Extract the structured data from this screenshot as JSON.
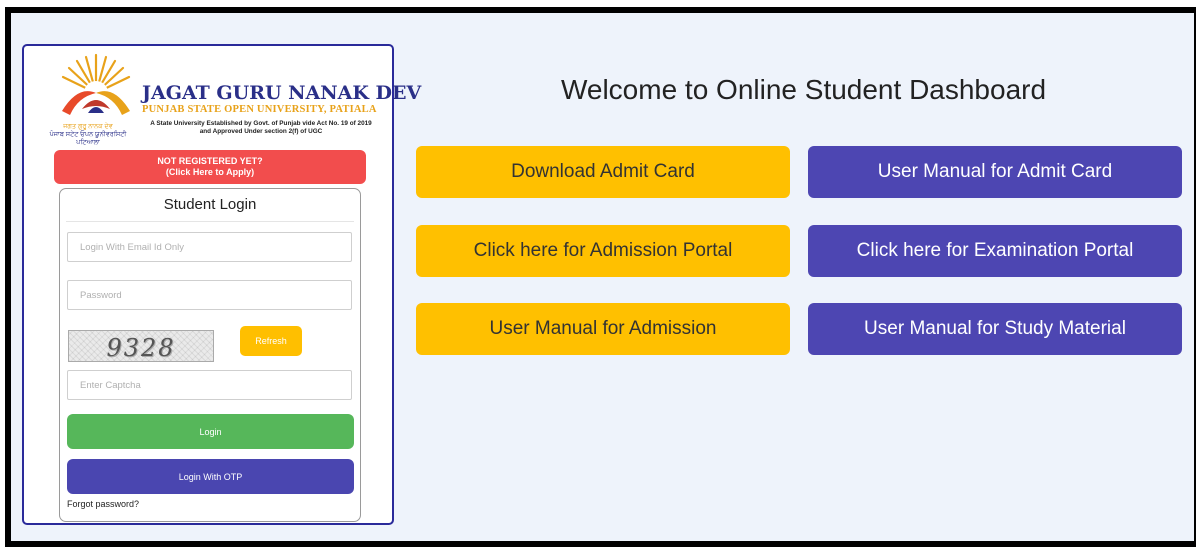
{
  "logo": {
    "name": "JAGAT GURU NANAK DEV",
    "subtitle": "PUNJAB STATE OPEN UNIVERSITY, PATIALA",
    "established_line1": "A State University Established by Govt. of Punjab vide Act No. 19 of 2019",
    "established_line2": "and Approved Under section 2(f) of UGC",
    "punjabi_line1": "ਜਗਤ ਗੁਰੂ ਨਾਨਕ ਦੇਵ",
    "punjabi_line2": "ਪੰਜਾਬ ਸਟੇਟ ਓਪਨ ਯੂਨੀਵਰਸਿਟੀ",
    "punjabi_line3": "ਪਟਿਆਲਾ"
  },
  "register": {
    "line1": "NOT REGISTERED YET?",
    "line2": "(Click Here to Apply)"
  },
  "login": {
    "title": "Student Login",
    "email_placeholder": "Login With Email Id Only",
    "password_placeholder": "Password",
    "captcha_text": "9328",
    "refresh_label": "Refresh",
    "captcha_placeholder": "Enter Captcha",
    "login_label": "Login",
    "otp_label": "Login With OTP",
    "forgot_label": "Forgot password?"
  },
  "main": {
    "welcome": "Welcome to Online Student Dashboard",
    "buttons": [
      {
        "label": "Download Admit Card",
        "color": "#ffc000"
      },
      {
        "label": "User Manual for Admit Card",
        "color": "#4d46b2"
      },
      {
        "label": "Click here for Admission Portal",
        "color": "#ffc000"
      },
      {
        "label": "Click here for Examination Portal",
        "color": "#4d46b2"
      },
      {
        "label": "User Manual for Admission",
        "color": "#ffc000"
      },
      {
        "label": "User Manual for Study Material",
        "color": "#4d46b2"
      }
    ]
  },
  "colors": {
    "background": "#eef3fb",
    "register_red": "#f24d4d",
    "login_green": "#56b75a",
    "otp_purple": "#4a46b0",
    "accent_yellow": "#ffc000"
  }
}
